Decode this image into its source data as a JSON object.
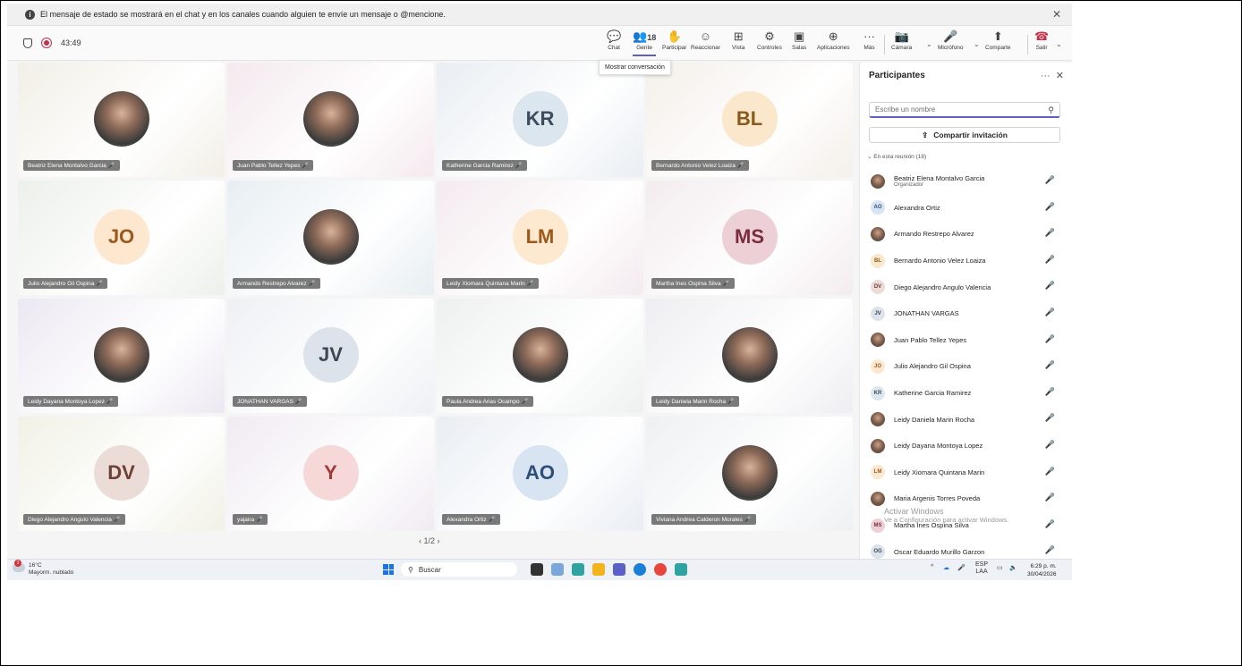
{
  "banner": {
    "text": "El mensaje de estado se mostrará en el chat y en los canales cuando alguien te envíe un mensaje o @mencione."
  },
  "toolbar": {
    "timer": "43:49",
    "people_count": "18",
    "items": [
      "Chat",
      "Gente",
      "Participar",
      "Reaccionar",
      "Vista",
      "Controles",
      "Salas",
      "Aplicaciones",
      "Más",
      "Cámara",
      "Micrófono",
      "Comparte",
      "Salir"
    ],
    "tooltip": "Mostrar conversación"
  },
  "tiles": [
    {
      "name": "Beatriz Elena Montalvo Garcia",
      "initials": "",
      "photo": true,
      "bg": "#f1efe6"
    },
    {
      "name": "Juan Pablo Tellez Yepes",
      "initials": "",
      "photo": true,
      "bg": "#f4e9ee"
    },
    {
      "name": "Katherine Garcia Ramirez",
      "initials": "KR",
      "photo": false,
      "bg": "#e9eef3",
      "av": "#dce6ef",
      "fg": "#3d4b5c"
    },
    {
      "name": "Bernardo Antonio Velez Loaiza",
      "initials": "BL",
      "photo": false,
      "bg": "#f4efe9",
      "av": "#fbe7cc",
      "fg": "#8a5a1a"
    },
    {
      "name": "Julio Alejandro Gil Ospina",
      "initials": "JO",
      "photo": false,
      "bg": "#ecf0ea",
      "av": "#fde8cf",
      "fg": "#9a5a1e"
    },
    {
      "name": "Armando Restrepo Alvarez",
      "initials": "",
      "photo": true,
      "bg": "#e7eef2"
    },
    {
      "name": "Leidy Xiomara Quintana Marin",
      "initials": "LM",
      "photo": false,
      "bg": "#f4eaef",
      "av": "#fde8d0",
      "fg": "#9b5a1c"
    },
    {
      "name": "Martha Ines Ospina Silva",
      "initials": "MS",
      "photo": false,
      "bg": "#f3ecef",
      "av": "#ecd0d6",
      "fg": "#7a2d3c"
    },
    {
      "name": "Leidy Dayana Montoya Lopez",
      "initials": "",
      "photo": true,
      "bg": "#ece8f2"
    },
    {
      "name": "JONATHAN VARGAS",
      "initials": "JV",
      "photo": false,
      "bg": "#eef0f4",
      "av": "#dde3ea",
      "fg": "#3b4756"
    },
    {
      "name": "Paula Andrea Arias Ocampo",
      "initials": "",
      "photo": true,
      "bg": "#eef0f0"
    },
    {
      "name": "Leidy Daniela Marin Rocha",
      "initials": "",
      "photo": true,
      "bg": "#eeeef2"
    },
    {
      "name": "Diego Alejandro Angulo Valencia",
      "initials": "DV",
      "photo": false,
      "bg": "#f1f1e6",
      "av": "#ecdcd8",
      "fg": "#6e4036"
    },
    {
      "name": "yajaira",
      "initials": "Y",
      "photo": false,
      "bg": "#f0ebf2",
      "av": "#f6d8d8",
      "fg": "#a33a3a"
    },
    {
      "name": "Alexandra Ortiz",
      "initials": "AO",
      "photo": false,
      "bg": "#e9eef4",
      "av": "#d8e4f2",
      "fg": "#2c4f78"
    },
    {
      "name": "Viviana Andrea Calderon Morales",
      "initials": "",
      "photo": true,
      "bg": "#eef0f2"
    }
  ],
  "pager": "1/2",
  "panel": {
    "title": "Participantes",
    "search_placeholder": "Escribe un nombre",
    "invite": "Compartir invitación",
    "section": "En esta reunión (18)",
    "people": [
      {
        "name": "Beatriz Elena Montalvo Garcia",
        "role": "Organizador",
        "initials": "",
        "photo": true
      },
      {
        "name": "Alexandra Ortiz",
        "role": "",
        "initials": "AO",
        "photo": false,
        "av": "#d8e4f2",
        "fg": "#2c4f78"
      },
      {
        "name": "Armando Restrepo Alvarez",
        "role": "",
        "initials": "",
        "photo": true
      },
      {
        "name": "Bernardo Antonio Velez Loaiza",
        "role": "",
        "initials": "BL",
        "photo": false,
        "av": "#fbe7cc",
        "fg": "#8a5a1a"
      },
      {
        "name": "Diego Alejandro Angulo Valencia",
        "role": "",
        "initials": "DV",
        "photo": false,
        "av": "#ecdcd8",
        "fg": "#6e4036"
      },
      {
        "name": "JONATHAN VARGAS",
        "role": "",
        "initials": "JV",
        "photo": false,
        "av": "#dde3ea",
        "fg": "#3b4756"
      },
      {
        "name": "Juan Pablo Tellez Yepes",
        "role": "",
        "initials": "",
        "photo": true
      },
      {
        "name": "Julio Alejandro Gil Ospina",
        "role": "",
        "initials": "JO",
        "photo": false,
        "av": "#fde8cf",
        "fg": "#9a5a1e"
      },
      {
        "name": "Katherine Garcia Ramirez",
        "role": "",
        "initials": "KR",
        "photo": false,
        "av": "#dce6ef",
        "fg": "#3d4b5c"
      },
      {
        "name": "Leidy Daniela Marin Rocha",
        "role": "",
        "initials": "",
        "photo": true
      },
      {
        "name": "Leidy Dayana Montoya Lopez",
        "role": "",
        "initials": "",
        "photo": true
      },
      {
        "name": "Leidy Xiomara Quintana Marin",
        "role": "",
        "initials": "LM",
        "photo": false,
        "av": "#fde8d0",
        "fg": "#9b5a1c"
      },
      {
        "name": "Maria Argenis Torres Poveda",
        "role": "",
        "initials": "",
        "photo": true
      },
      {
        "name": "Martha Ines Ospina Silva",
        "role": "",
        "initials": "MS",
        "photo": false,
        "av": "#ecd0d6",
        "fg": "#7a2d3c"
      },
      {
        "name": "Oscar Eduardo Murillo Garzon",
        "role": "",
        "initials": "OG",
        "photo": false,
        "av": "#dde3ea",
        "fg": "#3b4756"
      }
    ]
  },
  "watermark": {
    "line1": "Activar Windows",
    "line2": "Ve a Configuración para activar Windows."
  },
  "taskbar": {
    "temp": "16°C",
    "weather": "Mayorm. nublado",
    "weather_badge": "3",
    "search": "Buscar",
    "lang1": "ESP",
    "lang2": "LAA",
    "time": "6:29 p. m.",
    "date": "30/04/2026"
  }
}
